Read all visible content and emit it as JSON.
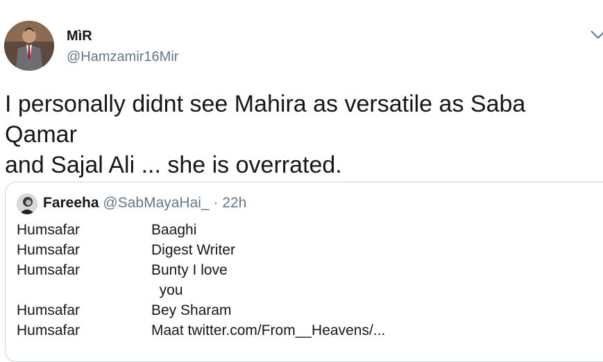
{
  "author": {
    "name": "MìR",
    "handle": "@Hamzamir16Mir"
  },
  "icons": {
    "menu": "chevron-down-icon"
  },
  "tweet": {
    "text_line1": "I personally didnt see Mahira as versatile as Saba Qamar",
    "text_line2": "and Sajal Ali ... she is overrated."
  },
  "quoted_tweet": {
    "name": "Fareeha",
    "handle": "@SabMayaHai_",
    "separator": "·",
    "time": "22h",
    "rows": [
      {
        "left": "Humsafar",
        "right": "Baaghi"
      },
      {
        "left": "Humsafar",
        "right": "Digest Writer"
      },
      {
        "left": "Humsafar",
        "right": "Bunty I love"
      },
      {
        "left": "",
        "right": "  you"
      },
      {
        "left": "Humsafar",
        "right": "Bey Sharam"
      },
      {
        "left": "Humsafar",
        "right": "Maat twitter.com/From__Heavens/..."
      }
    ]
  },
  "colors": {
    "text": "#14171a",
    "secondary": "#657786",
    "border": "#ccd6dd"
  }
}
